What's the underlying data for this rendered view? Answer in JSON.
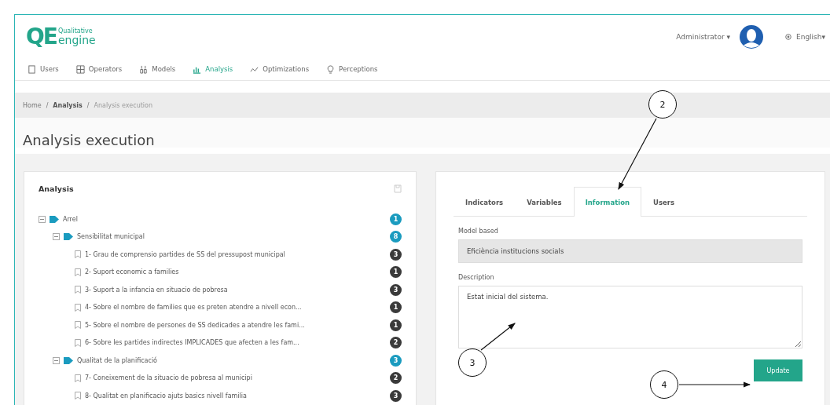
{
  "logo": {
    "mark": "QE",
    "line1": "Qualitative",
    "line2": "engine"
  },
  "user_menu": {
    "name": "Administrator",
    "caret": "▾"
  },
  "language_menu": {
    "label": "English",
    "caret": "▾"
  },
  "nav": [
    {
      "label": "Users",
      "selected": false
    },
    {
      "label": "Operators",
      "selected": false
    },
    {
      "label": "Models",
      "selected": false
    },
    {
      "label": "Analysis",
      "selected": true
    },
    {
      "label": "Optimizations",
      "selected": false
    },
    {
      "label": "Perceptions",
      "selected": false
    }
  ],
  "breadcrumb_separator": "/",
  "breadcrumb": [
    {
      "label": "Home",
      "current": false
    },
    {
      "label": "Analysis",
      "current": false
    },
    {
      "label": "Analysis execution",
      "current": true
    }
  ],
  "page_title": "Analysis execution",
  "analysis_panel": {
    "title": "Analysis",
    "tree": [
      {
        "kind": "group",
        "label": "Arrel",
        "count": "1",
        "expanded": true,
        "children": [
          {
            "kind": "group",
            "label": "Sensibilitat municipal",
            "count": "8",
            "expanded": true,
            "children": [
              {
                "kind": "indicator",
                "label": "1- Grau de comprensio partides de SS del pressupost municipal",
                "count": "3"
              },
              {
                "kind": "indicator",
                "label": "2- Suport economic a families",
                "count": "1"
              },
              {
                "kind": "indicator",
                "label": "3- Suport a la infancia en situacio de pobresa",
                "count": "3"
              },
              {
                "kind": "indicator",
                "label": "4- Sobre el nombre de families que es preten atendre a nivell econ...",
                "count": "1"
              },
              {
                "kind": "indicator",
                "label": "5- Sobre el nombre de persones de SS dedicades a atendre les fami...",
                "count": "1"
              },
              {
                "kind": "indicator",
                "label": "6- Sobre les partides indirectes IMPLICADES que afecten a les fam...",
                "count": "2"
              }
            ]
          },
          {
            "kind": "group",
            "label": "Qualitat de la planificació",
            "count": "3",
            "expanded": true,
            "children": [
              {
                "kind": "indicator",
                "label": "7- Coneixement de la situacio de pobresa al municipi",
                "count": "2"
              },
              {
                "kind": "indicator",
                "label": "8- Qualitat en planificacio ajuts basics nivell familia",
                "count": "3"
              }
            ]
          }
        ]
      }
    ]
  },
  "info_panel": {
    "tabs": [
      {
        "label": "Indicators",
        "selected": false
      },
      {
        "label": "Variables",
        "selected": false
      },
      {
        "label": "Information",
        "selected": true
      },
      {
        "label": "Users",
        "selected": false
      }
    ],
    "model_based": {
      "label": "Model based",
      "value": "Eficiència institucions socials",
      "disabled": true
    },
    "description": {
      "label": "Description",
      "value": "Estat inicial del sistema."
    },
    "update_button": "Update"
  },
  "callouts": [
    {
      "label": "2"
    },
    {
      "label": "3"
    },
    {
      "label": "4"
    }
  ]
}
